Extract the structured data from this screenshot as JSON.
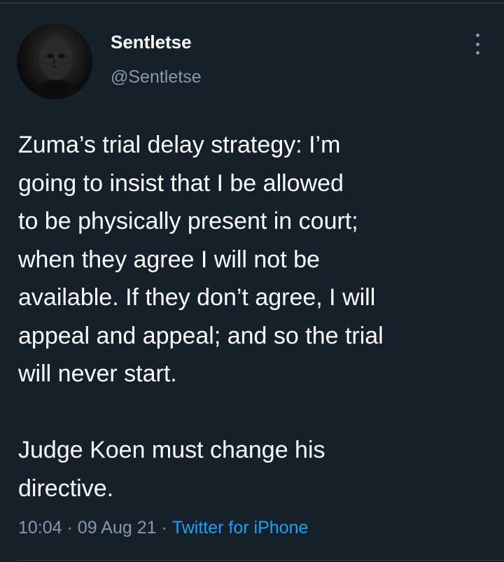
{
  "tweet": {
    "author": {
      "display_name": "Sentletse",
      "handle": "@Sentletse"
    },
    "text_paragraphs": [
      "Zuma’s trial delay strategy: I’m\ngoing to insist that I be allowed\nto be physically present in court;\nwhen they agree I will not be\navailable. If they don’t agree, I will\nappeal and appeal; and so the trial\nwill never start.",
      "Judge Koen must change his\ndirective."
    ],
    "time": "10:04",
    "date": "09 Aug 21",
    "separator": "·",
    "source": "Twitter for iPhone"
  },
  "icons": {
    "more": "more-vertical-icon",
    "avatar": "avatar"
  },
  "colors": {
    "background": "#15202b",
    "primary_text": "#ffffff",
    "secondary_text": "#8899a6",
    "link": "#1da1f2",
    "divider": "#2f3d4c"
  }
}
